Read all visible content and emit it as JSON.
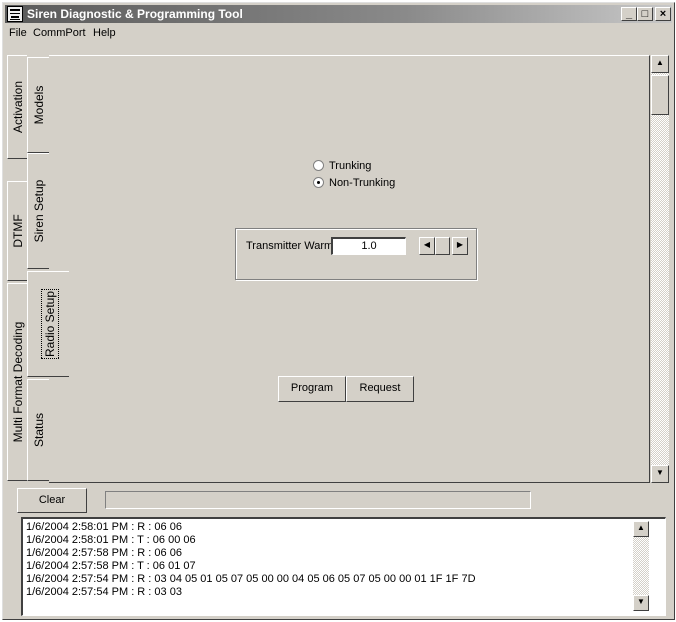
{
  "window": {
    "title": "Siren Diagnostic & Programming Tool",
    "controls": {
      "minimize": "_",
      "maximize": "□",
      "close": "×"
    }
  },
  "menu": [
    "File",
    "CommPort",
    "Help"
  ],
  "tabs_outer": [
    {
      "label": "Activation"
    },
    {
      "label": "DTMF"
    },
    {
      "label": "Multi Format Decoding"
    }
  ],
  "tabs_inner": [
    {
      "label": "Models"
    },
    {
      "label": "Siren Setup"
    },
    {
      "label": "Radio Setup",
      "active": true
    },
    {
      "label": "Status"
    }
  ],
  "radio_setup": {
    "options": [
      {
        "label": "Trunking",
        "selected": false
      },
      {
        "label": "Non-Trunking",
        "selected": true
      }
    ],
    "transmitter_warmup_label": "Transmitter Warmup :",
    "transmitter_warmup_value": "1.0",
    "program_label": "Program",
    "request_label": "Request"
  },
  "clear_label": "Clear",
  "log": [
    "1/6/2004 2:58:01 PM : R : 06 06",
    "1/6/2004 2:58:01 PM : T : 06 00 06",
    "1/6/2004 2:57:58 PM : R : 06 06",
    "1/6/2004 2:57:58 PM : T : 06 01 07",
    "1/6/2004 2:57:54 PM : R : 03 04 05 01 05 07 05 00 00 04 05 06 05 07 05 00 00 01 1F 1F 7D",
    "1/6/2004 2:57:54 PM : R : 03 03"
  ],
  "icons": {
    "app": "siren-app-icon",
    "scroll_up": "arrow-up-icon",
    "scroll_down": "arrow-down-icon",
    "scroll_left": "arrow-left-icon",
    "scroll_right": "arrow-right-icon"
  }
}
